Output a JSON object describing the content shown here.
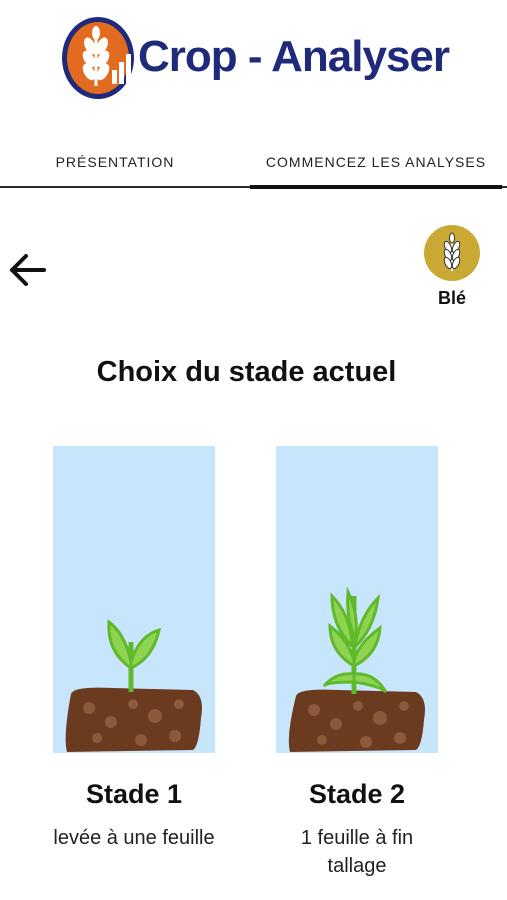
{
  "app": {
    "title": "Crop - Analyser"
  },
  "tabs": [
    {
      "label": "PRÉSENTATION"
    },
    {
      "label": "COMMENCEZ LES ANALYSES"
    }
  ],
  "crop": {
    "label": "Blé",
    "icon": "wheat-icon"
  },
  "page": {
    "title": "Choix du stade actuel"
  },
  "stages": [
    {
      "name": "Stade 1",
      "description": "levée à une feuille"
    },
    {
      "name": "Stade 2",
      "description": "1 feuille à fin tallage"
    }
  ],
  "colors": {
    "brand_blue": "#1f2a7a",
    "brand_orange": "#e36b1f",
    "badge_gold": "#c9a933",
    "sky": "#c7e6fb",
    "soil": "#6b3b1f",
    "leaf": "#7ec840"
  }
}
